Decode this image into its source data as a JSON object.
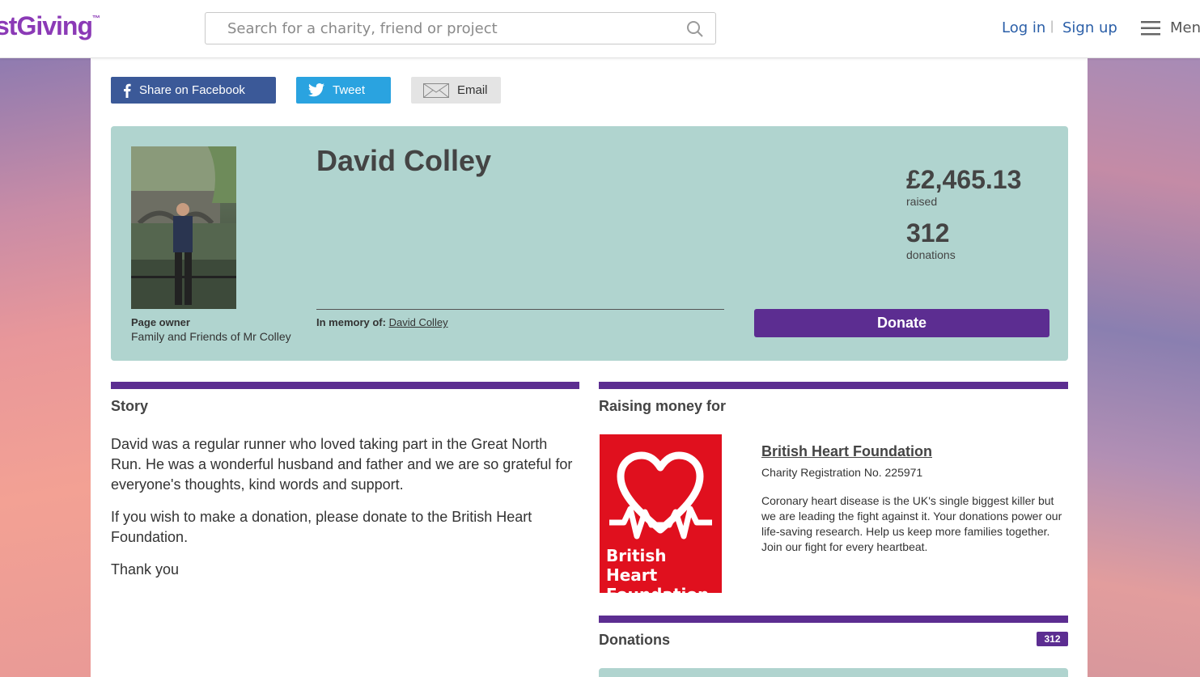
{
  "header": {
    "logo_text": "stGiving",
    "logo_mark": "™",
    "search_placeholder": "Search for a charity, friend or project",
    "login": "Log in",
    "separator": "|",
    "signup": "Sign up",
    "menu": "Menu"
  },
  "share": {
    "facebook": "Share on Facebook",
    "tweet": "Tweet",
    "email": "Email"
  },
  "hero": {
    "name": "David Colley",
    "owner_label": "Page owner",
    "owner_name": "Family and Friends of Mr Colley",
    "memory_label": "In memory of:",
    "memory_name": "David Colley",
    "raised_amount": "£2,465.13",
    "raised_label": "raised",
    "donations_count": "312",
    "donations_label": "donations",
    "donate_button": "Donate"
  },
  "story": {
    "title": "Story",
    "paragraphs": [
      "David was a regular runner who loved taking part in the Great North Run.  He was a wonderful husband and father and we are so grateful for everyone's thoughts, kind words and support.",
      "If you wish to make a donation, please donate to the British Heart Foundation.",
      "Thank you"
    ]
  },
  "raising": {
    "title": "Raising money for",
    "charity_name": "British Heart Foundation",
    "logo_text_1": "British Heart",
    "logo_text_2": "Foundation",
    "registration": "Charity Registration No. 225971",
    "description": "Coronary heart disease is the UK's single biggest killer but we are leading the fight against it. Your donations power our life-saving research. Help us keep more families together. Join our fight for every heartbeat."
  },
  "donations": {
    "title": "Donations",
    "badge": "312"
  },
  "colors": {
    "brand_purple": "#5c2d91",
    "hero_teal": "#b0d4cf",
    "facebook": "#3b5998",
    "twitter": "#2aa3e0",
    "bhf_red": "#e0101e",
    "link_blue": "#2b5fa8"
  }
}
